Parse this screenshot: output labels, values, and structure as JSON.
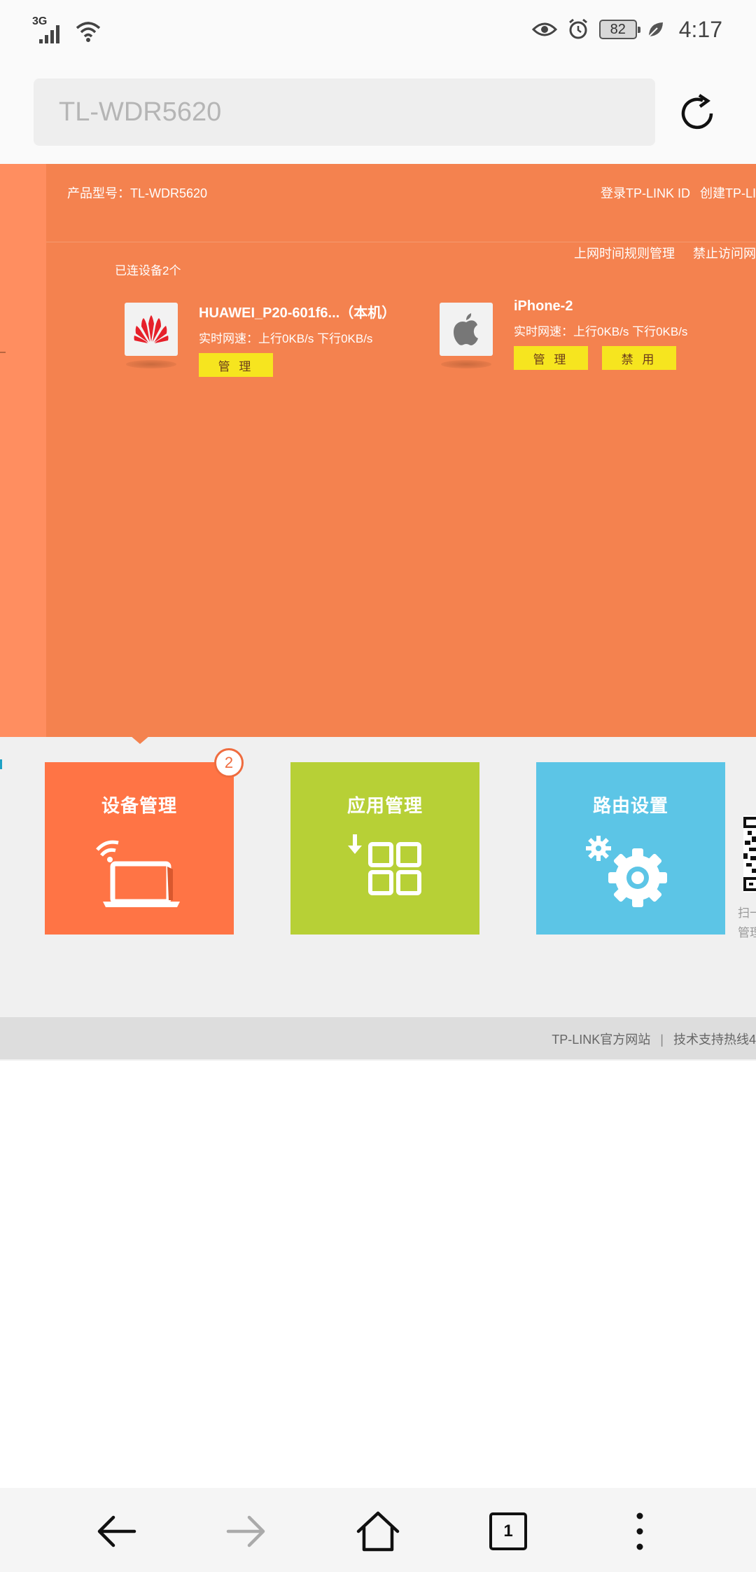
{
  "status_bar": {
    "network_type": "3G",
    "battery_level": "82",
    "time": "4:17"
  },
  "browser": {
    "url_text": "TL-WDR5620",
    "tab_count": "1"
  },
  "router_page": {
    "model_label": "产品型号：TL-WDR5620",
    "login_link": "登录TP-LINK ID",
    "create_link": "创建TP-LI",
    "time_rules_link": "上网时间规则管理",
    "block_link": "禁止访问网",
    "connected_count": "已连设备2个",
    "devices": [
      {
        "name": "HUAWEI_P20-601f6...（本机）",
        "speed": "实时网速：上行0KB/s  下行0KB/s",
        "manage_label": "管 理"
      },
      {
        "name": "iPhone-2",
        "speed": "实时网速：上行0KB/s  下行0KB/s",
        "manage_label": "管 理",
        "disable_label": "禁 用"
      }
    ],
    "tiles": [
      {
        "title": "设备管理",
        "badge": "2"
      },
      {
        "title": "应用管理"
      },
      {
        "title": "路由设置"
      }
    ],
    "qr_caption_1": "扫一",
    "qr_caption_2": "管理",
    "footer_site": "TP-LINK官方网站",
    "footer_hotline": "技术支持热线4"
  },
  "colors": {
    "panel_orange": "#f4824f",
    "device_tile": "#ff7445",
    "app_tile": "#b7d036",
    "router_tile": "#5cc5e6",
    "button_yellow": "#f6e51f"
  },
  "icons": {
    "status": [
      "signal-icon",
      "wifi-icon",
      "eye-icon",
      "alarm-icon",
      "battery-icon",
      "leaf-icon"
    ],
    "nav": [
      "back-arrow-icon",
      "forward-arrow-icon",
      "home-icon",
      "tabs-icon",
      "more-icon"
    ]
  }
}
